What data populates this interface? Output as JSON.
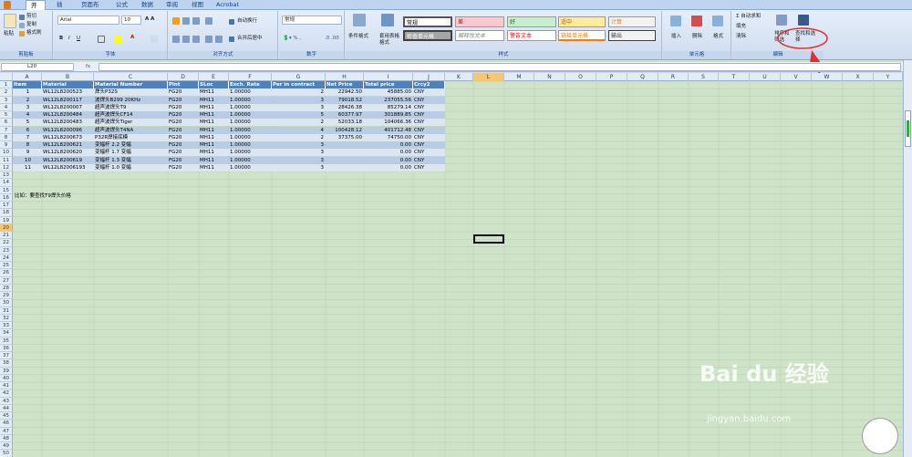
{
  "tabs": [
    "开始",
    "插入",
    "页面布局",
    "公式",
    "数据",
    "审阅",
    "视图",
    "Acrobat"
  ],
  "ribbon": {
    "clipboard": {
      "paste": "粘贴",
      "cut": "剪切",
      "copy": "复制",
      "format_painter": "格式刷",
      "label": "剪贴板"
    },
    "font": {
      "name": "Arial",
      "size": "10",
      "label": "字体"
    },
    "alignment": {
      "wrap": "自动换行",
      "merge": "合并后居中",
      "label": "对齐方式"
    },
    "number": {
      "format": "常规",
      "label": "数字"
    },
    "styles": {
      "conditional": "条件格式",
      "table": "套用表格格式",
      "cells": [
        "常规",
        "差",
        "好",
        "适中",
        "计算",
        "检查单元格",
        "解释性文本",
        "警告文本",
        "链接单元格",
        "输出"
      ],
      "label": "样式"
    },
    "cells": {
      "insert": "插入",
      "delete": "删除",
      "format": "格式",
      "label": "单元格"
    },
    "editing": {
      "autosum": "Σ 自动求和",
      "fill": "填充",
      "clear": "清除",
      "sort": "排序和筛选",
      "find": "查找和选择",
      "label": "编辑"
    }
  },
  "formula_bar": {
    "name_box": "L20",
    "fx": "fx",
    "value": ""
  },
  "sheet": {
    "columns": [
      "A",
      "B",
      "C",
      "D",
      "E",
      "F",
      "G",
      "H",
      "I",
      "J",
      "K",
      "L",
      "M",
      "N",
      "O",
      "P",
      "Q",
      "R",
      "S",
      "T",
      "U",
      "V",
      "W",
      "X",
      "Y"
    ],
    "headers": [
      "Item",
      "Material",
      "Material Number",
      "Plnt",
      "SLoc",
      "Exch. Rate",
      "Per in contract",
      "Net Price",
      "Total price",
      "Crcy2"
    ],
    "rows": [
      [
        "1",
        "WL12L8200523",
        "焊头P32S",
        "FG20",
        "MH11",
        "1.00000",
        "2",
        "22942.50",
        "45885.00",
        "CNY"
      ],
      [
        "2",
        "WL12L8200117",
        "波焊头B299 20KHz",
        "FG20",
        "MH11",
        "1.00000",
        "3",
        "79018.52",
        "237055.56",
        "CNY"
      ],
      [
        "3",
        "WL12L8200007",
        "超声波焊头T9",
        "FG20",
        "MH11",
        "1.00000",
        "3",
        "28426.38",
        "85279.14",
        "CNY"
      ],
      [
        "4",
        "WL12L8200484",
        "超声波焊头CF14",
        "FG20",
        "MH11",
        "1.00000",
        "5",
        "60377.97",
        "301889.85",
        "CNY"
      ],
      [
        "5",
        "WL12L8200483",
        "超声波焊头Tiger",
        "FG20",
        "MH11",
        "1.00000",
        "2",
        "52033.18",
        "104066.36",
        "CNY"
      ],
      [
        "6",
        "WL12L8200096",
        "超声波焊头T4NA",
        "FG20",
        "MH11",
        "1.00000",
        "4",
        "100428.12",
        "401712.48",
        "CNY"
      ],
      [
        "7",
        "WL12L8200673",
        "P32R焊接底模",
        "FG20",
        "MH11",
        "1.00000",
        "2",
        "37375.00",
        "74750.00",
        "CNY"
      ],
      [
        "8",
        "WL12L8200621",
        "变幅杆 2.2 变幅",
        "FG20",
        "MH11",
        "1.00000",
        "3",
        "",
        "0.00",
        "CNY"
      ],
      [
        "9",
        "WL12L8200620",
        "变幅杆 1.7 变幅",
        "FG20",
        "MH11",
        "1.00000",
        "3",
        "",
        "0.00",
        "CNY"
      ],
      [
        "10",
        "WL12L8200619",
        "变幅杆 1.3 变幅",
        "FG20",
        "MH11",
        "1.00000",
        "3",
        "",
        "0.00",
        "CNY"
      ],
      [
        "11",
        "WL12L82006193",
        "变幅杆 1.0 变幅",
        "FG20",
        "MH11",
        "1.00000",
        "3",
        "",
        "0.00",
        "CNY"
      ]
    ],
    "note": "比如：要查找T9焊头价格"
  },
  "watermark": {
    "brand": "Bai du 经验",
    "url": "jingyan.baidu.com"
  }
}
